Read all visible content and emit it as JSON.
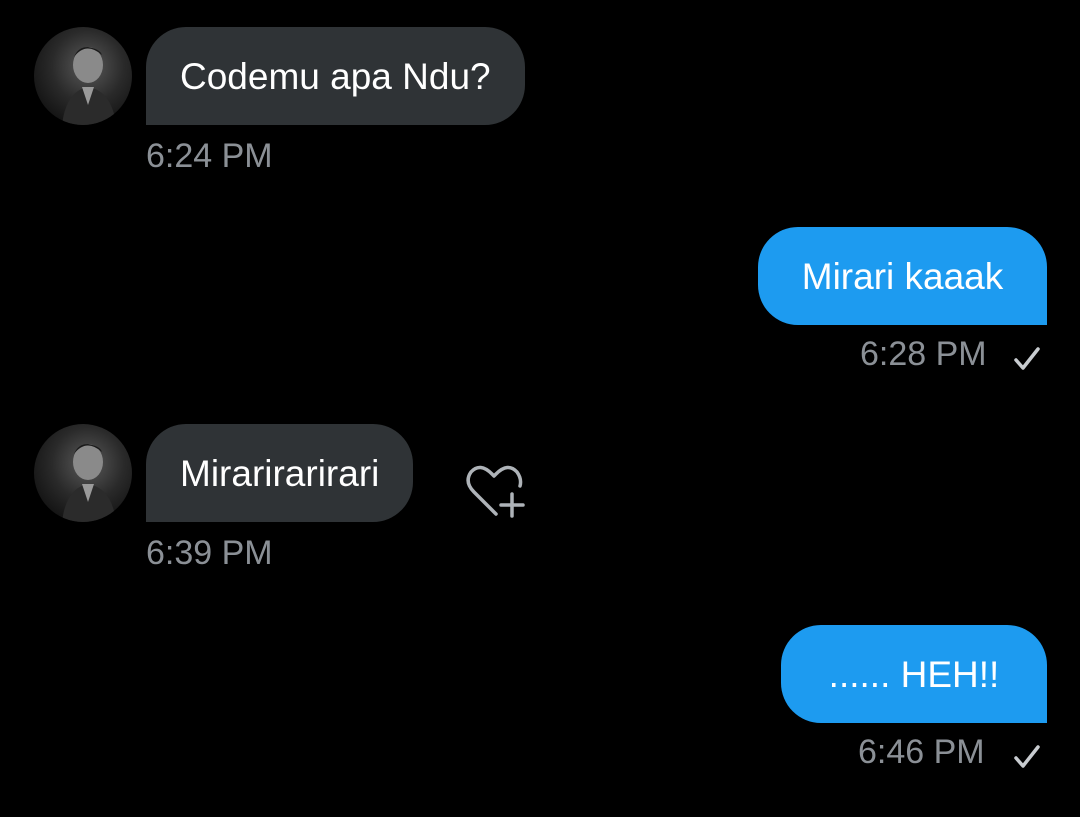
{
  "messages": [
    {
      "direction": "in",
      "text": "Codemu apa Ndu?",
      "time": "6:24 PM"
    },
    {
      "direction": "out",
      "text": "Mirari kaaak",
      "time": "6:28 PM",
      "status": "sent"
    },
    {
      "direction": "in",
      "text": "Mirarirarirari",
      "time": "6:39 PM",
      "reaction_icon": "heart-plus-icon"
    },
    {
      "direction": "out",
      "text": "...... HEH!!",
      "time": "6:46 PM",
      "status": "sent"
    }
  ],
  "colors": {
    "background": "#000000",
    "incoming_bubble": "#2f3336",
    "outgoing_bubble": "#1d9bf0",
    "timestamp": "#8b9096"
  }
}
